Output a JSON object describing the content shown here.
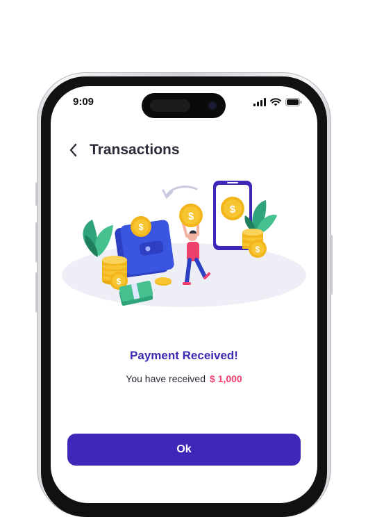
{
  "status_bar": {
    "time": "9:09"
  },
  "header": {
    "title": "Transactions"
  },
  "message": {
    "title": "Payment Received!",
    "body": "You have received",
    "amount": "$ 1,000"
  },
  "actions": {
    "ok_label": "Ok"
  },
  "colors": {
    "primary": "#3d28b8",
    "title_purple": "#3a2bb0",
    "amount_pink": "#ef3f6b",
    "coin_gold": "#f7c531"
  },
  "icons": [
    "back-icon",
    "signal-icon",
    "wifi-icon",
    "battery-icon",
    "coin-icon",
    "wallet-icon",
    "phone-icon"
  ]
}
